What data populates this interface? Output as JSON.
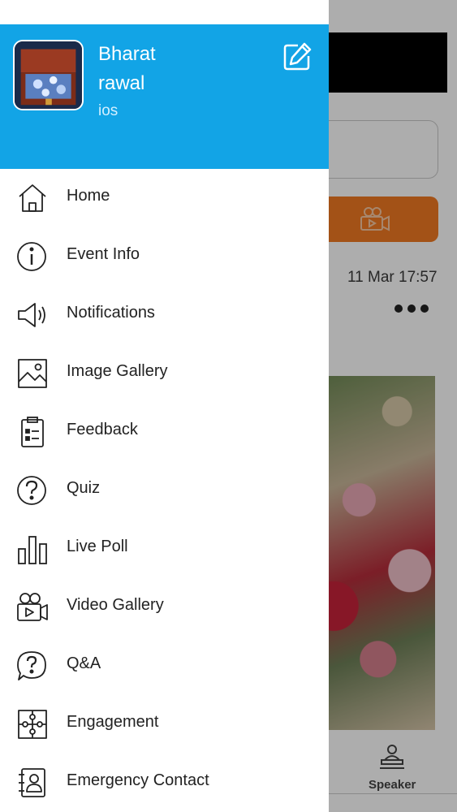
{
  "background": {
    "timestamp": "11 Mar 17:57",
    "tab_label": "Speaker"
  },
  "drawer": {
    "user": {
      "first_name": "Bharat",
      "last_name": "rawal",
      "platform": "ios"
    },
    "header_color": "#12a4e6",
    "menu": [
      {
        "label": "Home",
        "icon": "home-icon"
      },
      {
        "label": "Event Info",
        "icon": "info-icon"
      },
      {
        "label": "Notifications",
        "icon": "megaphone-icon"
      },
      {
        "label": "Image Gallery",
        "icon": "image-icon"
      },
      {
        "label": "Feedback",
        "icon": "clipboard-icon"
      },
      {
        "label": "Quiz",
        "icon": "question-icon"
      },
      {
        "label": "Live Poll",
        "icon": "bar-chart-icon"
      },
      {
        "label": "Video Gallery",
        "icon": "video-camera-icon"
      },
      {
        "label": "Q&A",
        "icon": "chat-question-icon"
      },
      {
        "label": "Engagement",
        "icon": "puzzle-icon"
      },
      {
        "label": "Emergency Contact",
        "icon": "contact-book-icon"
      }
    ]
  }
}
